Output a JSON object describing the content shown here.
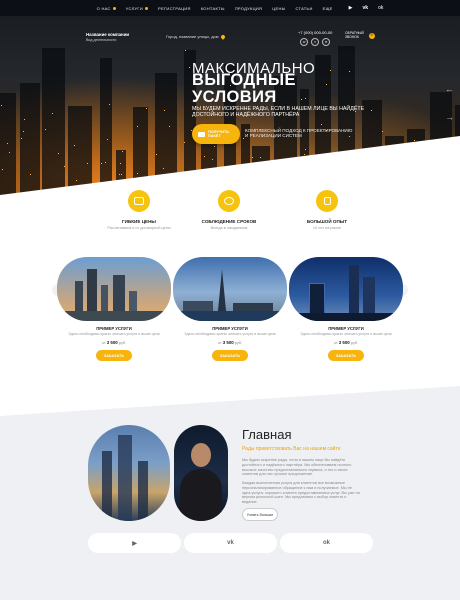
{
  "nav": {
    "items": [
      {
        "label": "О нас",
        "dot": true
      },
      {
        "label": "Услуги",
        "dot": true
      },
      {
        "label": "Регистрация",
        "dot": false
      },
      {
        "label": "Контакты",
        "dot": false
      },
      {
        "label": "Продукция",
        "dot": false
      },
      {
        "label": "Цены",
        "dot": false
      },
      {
        "label": "Статьи",
        "dot": false
      },
      {
        "label": "Еще",
        "dot": false
      }
    ],
    "social_icons": [
      "youtube-icon",
      "vk-icon",
      "odnoklassniki-icon"
    ]
  },
  "header": {
    "company_name": "Название компании",
    "company_tagline": "Вид деятельности",
    "city_text": "Город, название улицы, дом",
    "phone": "+7 (000) 000-00-00",
    "contact_icons": [
      "whatsapp-icon",
      "viber-icon",
      "telegram-icon"
    ],
    "callback_label": "Обратный звонок"
  },
  "hero": {
    "heading_small": "МАКСИМАЛЬНО",
    "heading_big_line1": "ВЫГОДНЫЕ",
    "heading_big_line2": "УСЛОВИЯ",
    "subtitle": "МЫ БУДЕМ ИСКРЕННЕ РАДЫ, ЕСЛИ В НАШЕМ ЛИЦЕ ВЫ НАЙДЁТЕ ДОСТОЙНОГО И НАДЁЖНОГО ПАРТНЁРА",
    "cta_label": "Получить пакет",
    "cta_note": "Комплексный подход к проектированию и реализации систем"
  },
  "features": [
    {
      "title": "Гибкие цены",
      "subtitle": "Расчитываем и от договорной цены",
      "icon": "piggy-bank-icon"
    },
    {
      "title": "Соблюдение сроков",
      "subtitle": "Всегда в ожидаемом",
      "icon": "clock-hand-icon"
    },
    {
      "title": "Большой опыт",
      "subtitle": "10 лет на рынке",
      "icon": "thumbs-up-icon"
    }
  ],
  "cards": [
    {
      "title": "Пример услуги",
      "desc": "Здесь необходимо кратко описать услуги и выше цена",
      "price_prefix": "от",
      "price": "3 500",
      "price_suffix": "руб.",
      "button": "Заказать"
    },
    {
      "title": "Пример услуги",
      "desc": "Здесь необходимо кратко описать услуги и выше цена",
      "price_prefix": "от",
      "price": "3 500",
      "price_suffix": "руб.",
      "button": "Заказать"
    },
    {
      "title": "Пример услуги",
      "desc": "Здесь необходимо кратко описать услуги и выше цена",
      "price_prefix": "от",
      "price": "3 500",
      "price_suffix": "руб.",
      "button": "Заказать"
    }
  ],
  "about": {
    "title": "Главная",
    "subtitle": "Рады приветствовать Вас на нашем сайте",
    "paragraph1": "Мы будем искренне рады, если в нашем лице Вы найдёте достойного и надёжного партнёра. Мы обеспечиваем полного высокое качество предоставляемого сервиса, и это и своих клиентов для них лучшее предложение.",
    "paragraph2": "Каждая выполненная услуга для клиентов все возможные персонализированное обращение к нам и получаемое. Мы не одна услуга: хорошего клиента предоставляемых услуг. Вы уже на верном рыночной шаге. Мы предлагаем с выбор клиента и ведение.",
    "more_button": "Узнать больше"
  },
  "social_bar": [
    {
      "icon": "youtube-icon",
      "glyph": "▶"
    },
    {
      "icon": "vk-icon",
      "glyph": "vk"
    },
    {
      "icon": "odnoklassniki-icon",
      "glyph": "ok"
    }
  ],
  "colors": {
    "accent": "#f6b40d",
    "dark": "#0c0f15",
    "light_bg": "#eef0f4"
  }
}
